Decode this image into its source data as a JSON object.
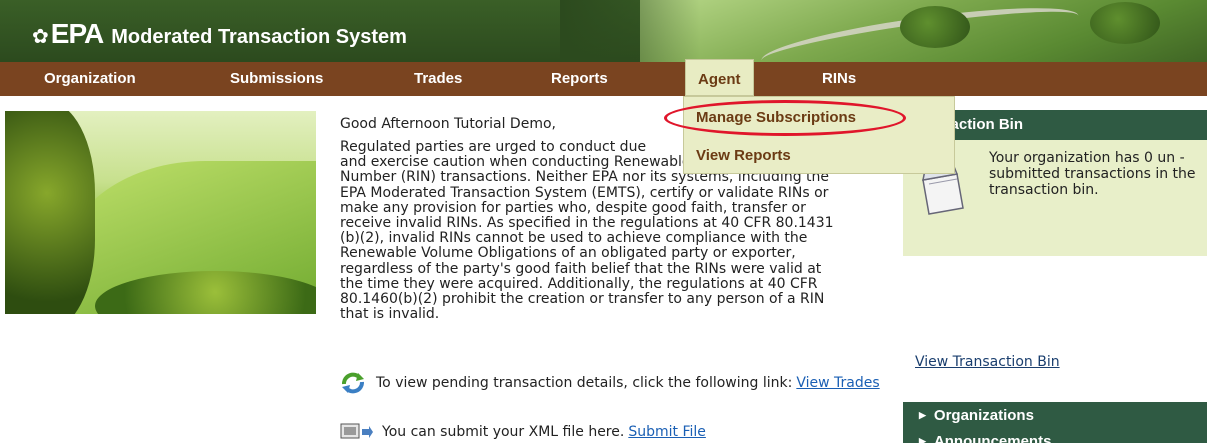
{
  "header": {
    "logo_symbol": "✿",
    "logo_text": "EPA",
    "system_name": "Moderated Transaction System"
  },
  "nav": {
    "items": [
      {
        "label": "Organization"
      },
      {
        "label": "Submissions"
      },
      {
        "label": "Trades"
      },
      {
        "label": "Reports"
      },
      {
        "label": "Agent"
      },
      {
        "label": "RINs"
      }
    ]
  },
  "dropdown": {
    "items": [
      {
        "label": "Manage Subscriptions"
      },
      {
        "label": "View Reports"
      }
    ]
  },
  "main": {
    "greeting": "Good Afternoon Tutorial Demo,",
    "disclaimer_lines": [
      "Regulated parties are urged to conduct due",
      "and exercise caution when conducting Renewable Identification",
      "Number (RIN) transactions. Neither EPA nor its systems, including the",
      "EPA Moderated Transaction System (EMTS), certify or validate RINs or",
      "make any provision for parties who, despite good faith, transfer or",
      "receive invalid RINs. As specified in the regulations at 40 CFR 80.1431",
      "(b)(2), invalid RINs cannot be used to achieve compliance with the",
      "Renewable Volume Obligations of an obligated party or exporter,",
      "regardless of the party's good faith belief that the RINs were valid at",
      "the time they were acquired. Additionally, the regulations at 40 CFR",
      "80.1460(b)(2) prohibit the creation or transfer to any person of a RIN",
      "that is invalid."
    ],
    "pending_text": "To view pending transaction details, click the following link:",
    "pending_link": "View Trades",
    "submit_text": "You can submit your XML file here.",
    "submit_link": "Submit File"
  },
  "right_panel": {
    "bin_header": "nsaction Bin",
    "bin_message": "Your organization has 0 un -submitted transactions in the transaction bin.",
    "view_bin_link": "View Transaction Bin",
    "sections": [
      {
        "label": "Organizations"
      },
      {
        "label": "Announcements"
      }
    ]
  },
  "colors": {
    "nav_bg": "#7a4420",
    "panel_green": "#2f5a43",
    "dropdown_bg": "#e9edc6",
    "highlight_ring": "#e0162b",
    "link": "#1a5fb4"
  }
}
